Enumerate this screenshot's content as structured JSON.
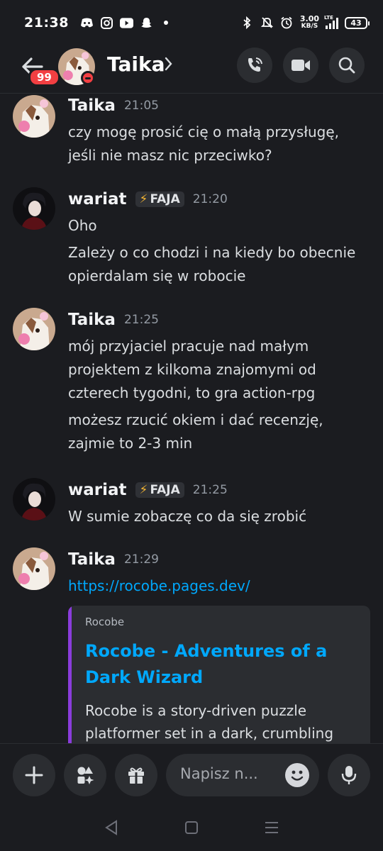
{
  "status_bar": {
    "time": "21:38",
    "net_speed_value": "3.00",
    "net_speed_unit": "KB/S",
    "network": "LTE",
    "battery": "43"
  },
  "header": {
    "unread_badge": "99",
    "title": "Taika",
    "icons": [
      "back-arrow-icon",
      "phone-call-icon",
      "video-camera-icon",
      "search-icon"
    ]
  },
  "messages": [
    {
      "author": "Taika",
      "time": "21:05",
      "lines": [
        "czy mogę prosić cię o małą przysługę, jeśli nie masz nic przeciwko?"
      ]
    },
    {
      "author": "wariat",
      "tag": "FAJA",
      "time": "21:20",
      "lines": [
        "Oho",
        "Zależy o co chodzi i na kiedy bo obecnie opierdalam się w robocie"
      ]
    },
    {
      "author": "Taika",
      "time": "21:25",
      "lines": [
        "mój przyjaciel pracuje nad małym projektem z kilkoma znajomymi od czterech tygodni, to gra action-rpg",
        "możesz rzucić okiem i dać recenzję, zajmie to 2-3 min"
      ]
    },
    {
      "author": "wariat",
      "tag": "FAJA",
      "time": "21:25",
      "lines": [
        "W sumie zobaczę co da się zrobić"
      ]
    },
    {
      "author": "Taika",
      "time": "21:29",
      "link": "https://rocobe.pages.dev/",
      "embed": {
        "provider": "Rocobe",
        "title": "Rocobe - Adventures of a Dark Wizard",
        "description": "Rocobe is a story-driven puzzle platformer set in a dark, crumbling"
      }
    }
  ],
  "composer": {
    "placeholder": "Napisz n...",
    "icons": [
      "plus-icon",
      "apps-icon",
      "gift-icon",
      "emoji-icon",
      "microphone-icon"
    ]
  },
  "colors": {
    "background": "#1b1c20",
    "link": "#00a8fc",
    "embed_accent": "#8a3cdc",
    "badge": "#f23f42"
  }
}
